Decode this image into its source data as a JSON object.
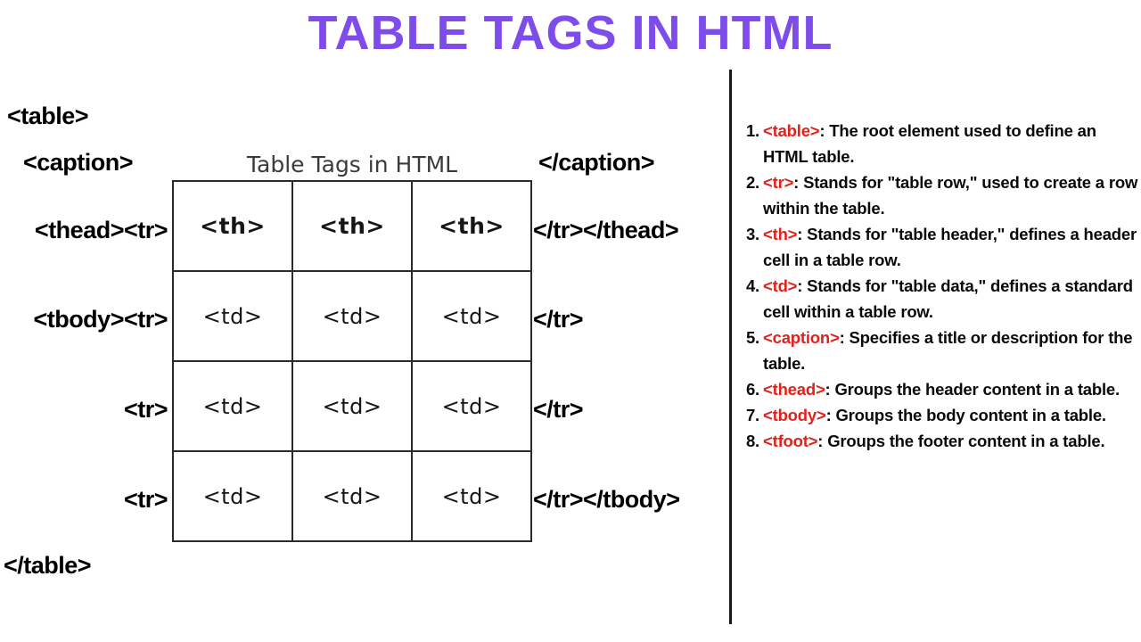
{
  "page": {
    "title": "TABLE TAGS IN HTML",
    "title_color": "#7f4cec",
    "accent_red": "#e2211a",
    "text_color": "#0a0a0a",
    "background": "#ffffff"
  },
  "diagram": {
    "left_labels": {
      "table_open": "<table>",
      "caption_open": "<caption>",
      "thead_tr_open": "<thead><tr>",
      "tbody_tr_open": "<tbody><tr>",
      "tr_open_2": "<tr>",
      "tr_open_3": "<tr>",
      "table_close": "</table>"
    },
    "right_labels": {
      "caption_close": "</caption>",
      "tr_thead_close": "</tr></thead>",
      "tr_close_1": "</tr>",
      "tr_close_2": "</tr>",
      "tr_tbody_close": "</tr></tbody>"
    },
    "table": {
      "caption": "Table Tags in HTML",
      "header_row": [
        "<th>",
        "<th>",
        "<th>"
      ],
      "body_rows": [
        [
          "<td>",
          "<td>",
          "<td>"
        ],
        [
          "<td>",
          "<td>",
          "<td>"
        ],
        [
          "<td>",
          "<td>",
          "<td>"
        ]
      ]
    }
  },
  "explanations": {
    "items": [
      {
        "number": "1.",
        "tag": "<table>",
        "desc": ": The root element used to define an HTML table."
      },
      {
        "number": "2.",
        "tag": "<tr>",
        "desc": ": Stands for \"table row,\" used to create a row within the table."
      },
      {
        "number": "3.",
        "tag": "<th>",
        "desc": ": Stands for \"table header,\" defines a header cell in a table row."
      },
      {
        "number": "4.",
        "tag": "<td>",
        "desc": ": Stands for \"table data,\" defines a standard cell within a table row."
      },
      {
        "number": "5.",
        "tag": "<caption>",
        "desc": ": Specifies a title or description for the table."
      },
      {
        "number": "6.",
        "tag": "<thead>",
        "desc": ": Groups the header content in a table."
      },
      {
        "number": "7.",
        "tag": "<tbody>",
        "desc": ": Groups the body content in a table."
      },
      {
        "number": "8.",
        "tag": "<tfoot>",
        "desc": ": Groups the footer content in a table."
      }
    ]
  }
}
